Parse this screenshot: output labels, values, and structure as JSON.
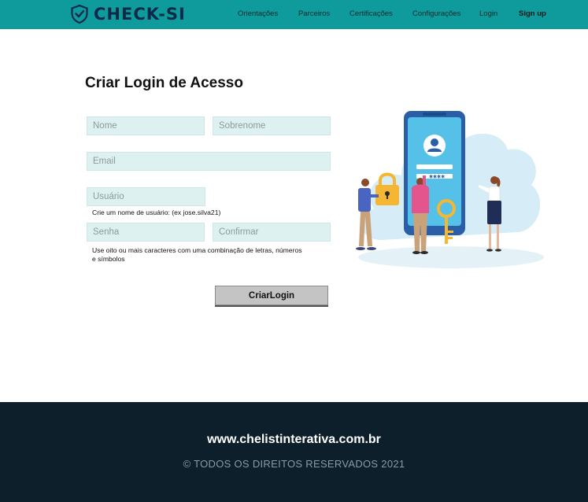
{
  "brand": {
    "name": "CHECK-SI",
    "bar_color": "#0f9b9b"
  },
  "nav": [
    "Orientações",
    "Parceiros",
    "Certificações",
    "Configurações",
    "Login",
    "Sign up"
  ],
  "form": {
    "title": "Criar Login de Acesso",
    "first_name_placeholder": "Nome",
    "last_name_placeholder": "Sobrenome",
    "email_placeholder": "Email",
    "username_placeholder": "Usuário",
    "username_hint": "Crie um nome de usuário: (ex jose.silva21)",
    "password_placeholder": "Senha",
    "confirm_placeholder": "Confirmar",
    "password_hint_line1": "Use oito ou mais caracteres com uma combinação de letras, números",
    "password_hint_line2": "e símbolos",
    "submit_label": "CriarLogin",
    "field_color": "#def1f1"
  },
  "footer": {
    "url": "www.chelistinterativa.com.br",
    "copyright": "© TODOS OS DIREITOS RESERVADOS 2021",
    "bg_color": "#0c1f2b"
  }
}
